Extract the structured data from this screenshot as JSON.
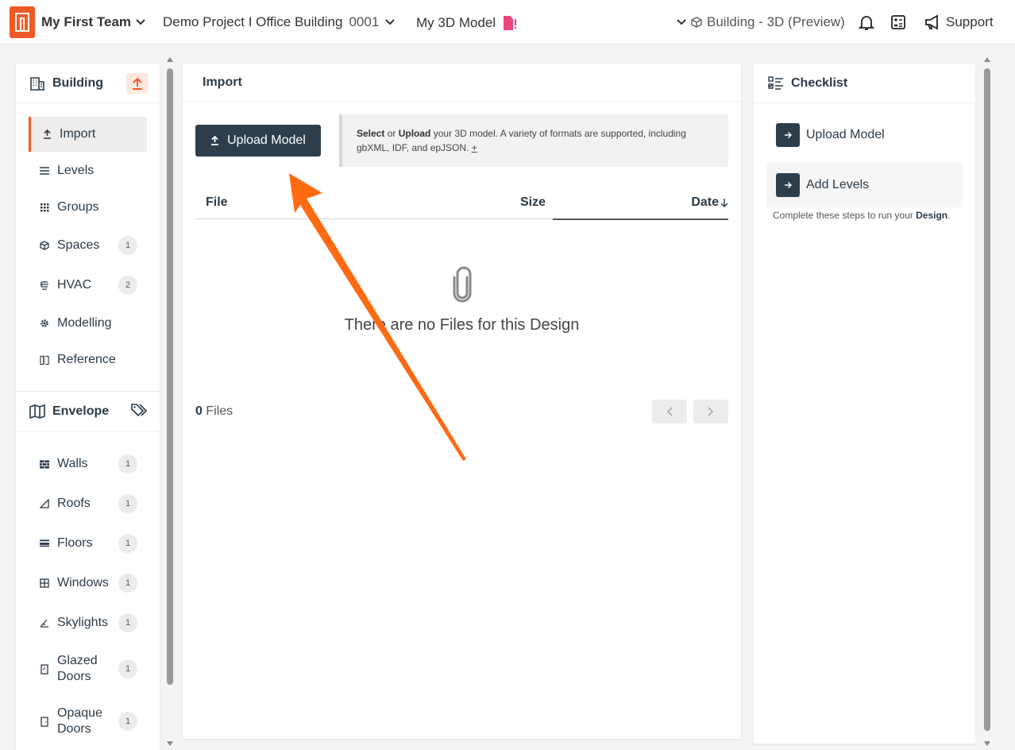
{
  "topbar": {
    "team": "My First Team",
    "project_name": "Demo Project I Office Building",
    "project_number": "0001",
    "model": "My 3D Model",
    "view": "Building - 3D (Preview)",
    "support": "Support"
  },
  "sidebar": {
    "building_title": "Building",
    "building_items": [
      {
        "label": "Import",
        "icon": "upload-icon",
        "badge": null
      },
      {
        "label": "Levels",
        "icon": "lines-icon",
        "badge": null
      },
      {
        "label": "Groups",
        "icon": "grid-icon",
        "badge": null
      },
      {
        "label": "Spaces",
        "icon": "cube-icon",
        "badge": "1"
      },
      {
        "label": "HVAC",
        "icon": "hvac-icon",
        "badge": "2"
      },
      {
        "label": "Modelling",
        "icon": "gear-icon",
        "badge": null
      },
      {
        "label": "Reference",
        "icon": "reference-icon",
        "badge": null
      }
    ],
    "envelope_title": "Envelope",
    "envelope_items": [
      {
        "label": "Walls",
        "icon": "wall-icon",
        "badge": "1"
      },
      {
        "label": "Roofs",
        "icon": "roof-icon",
        "badge": "1"
      },
      {
        "label": "Floors",
        "icon": "floor-icon",
        "badge": "1"
      },
      {
        "label": "Windows",
        "icon": "window-icon",
        "badge": "1"
      },
      {
        "label": "Skylights",
        "icon": "skylight-icon",
        "badge": "1"
      },
      {
        "label": "Glazed Doors",
        "line1": "Glazed",
        "line2": "Doors",
        "icon": "glazed-door-icon",
        "badge": "1"
      },
      {
        "label": "Opaque Doors",
        "line1": "Opaque",
        "line2": "Doors",
        "icon": "opaque-door-icon",
        "badge": "1"
      }
    ]
  },
  "main": {
    "title": "Import",
    "upload_button": "Upload Model",
    "info_select": "Select",
    "info_or": "or",
    "info_upload": "Upload",
    "info_rest": "your 3D model. A variety of formats are supported, including gbXML, IDF, and epJSON.",
    "info_more": "+",
    "col_file": "File",
    "col_size": "Size",
    "col_date": "Date",
    "empty_text": "There are no Files for this Design",
    "files_count": "0",
    "files_label": "Files"
  },
  "checklist": {
    "title": "Checklist",
    "items": [
      "Upload Model",
      "Add Levels"
    ],
    "note_prefix": "Complete these steps to run your",
    "note_bold": "Design",
    "note_suffix": "."
  },
  "colors": {
    "accent": "#f05a28",
    "dark": "#2c3e4c",
    "arrow": "#ff6a13"
  }
}
